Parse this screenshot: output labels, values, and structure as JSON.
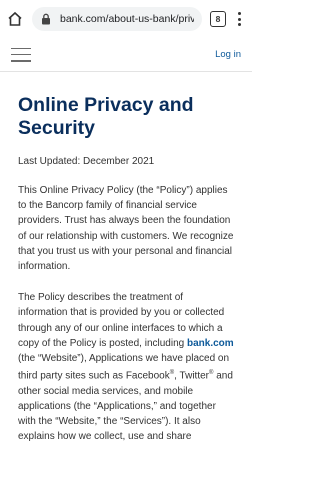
{
  "browser": {
    "url": "bank.com/about-us-bank/priv",
    "tab_count": "8"
  },
  "header": {
    "login_label": "Log in"
  },
  "main": {
    "title": "Online Privacy and Security",
    "last_updated": "Last Updated: December 2021",
    "paragraph_1": "This Online Privacy Policy (the “Policy”) applies to the Bancorp family of financial service providers. Trust has always been the foundation of our relationship with customers. We recognize that you trust us with your personal and financial information.",
    "p2_part1": "The Policy describes the treatment of information that is provided by you or collected through any of our online interfaces to which a copy of the Policy is posted, including ",
    "p2_link": "bank.com",
    "p2_part2": " (the “Website”), Applications we have placed on third party sites such as Facebook",
    "p2_reg": "®",
    "p2_part3": ", Twitter",
    "p2_part4": " and other social media services, and mobile applications (the “Applications,” and together with the “Website,” the “Services”). It also explains how we collect, use and share"
  }
}
